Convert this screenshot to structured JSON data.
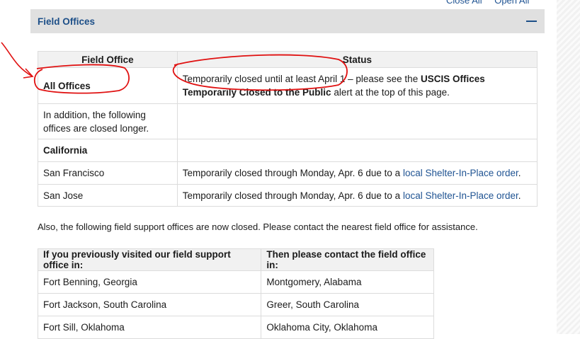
{
  "top_links": {
    "close_all": "Close All",
    "open_all": "Open All"
  },
  "accordion": {
    "title": "Field Offices"
  },
  "status_table": {
    "headers": [
      "Field Office",
      "Status"
    ],
    "rows": [
      {
        "office": "All Offices",
        "status_pre": "Temporarily closed until at least April 1 – please see the ",
        "status_bold": "USCIS Offices Temporarily Closed to the Public",
        "status_post": " alert at the top of this page."
      },
      {
        "office": "In addition, the following offices are closed longer."
      },
      {
        "office": "California"
      },
      {
        "office": "San Francisco",
        "status_pre": "Temporarily closed through Monday, Apr. 6 due to a ",
        "status_link": "local Shelter-In-Place order",
        "status_post": "."
      },
      {
        "office": "San Jose",
        "status_pre": "Temporarily closed through Monday, Apr. 6 due to a ",
        "status_link": "local Shelter-In-Place order",
        "status_post": "."
      }
    ]
  },
  "note": "Also, the following field support offices are now closed. Please contact the nearest field office for assistance.",
  "support_table": {
    "headers": [
      "If you previously visited our field support office in:",
      "Then please contact the field office in:"
    ],
    "rows": [
      [
        "Fort Benning, Georgia",
        "Montgomery, Alabama"
      ],
      [
        "Fort Jackson, South Carolina",
        "Greer, South Carolina"
      ],
      [
        "Fort Sill, Oklahoma",
        "Oklahoma City, Oklahoma"
      ]
    ]
  },
  "colors": {
    "accent": "#205493",
    "annotation": "#e01010",
    "header_bg": "#e0e0e0"
  }
}
